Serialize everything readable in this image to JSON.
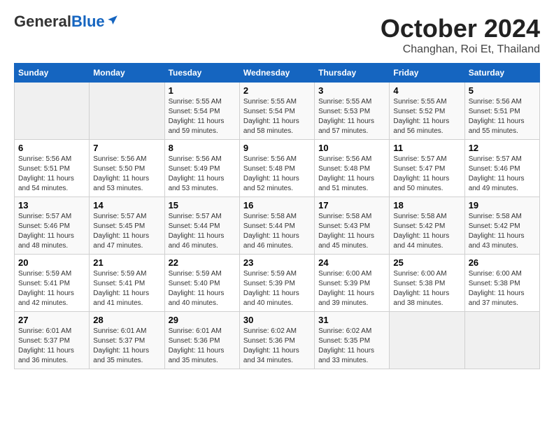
{
  "header": {
    "logo_general": "General",
    "logo_blue": "Blue",
    "month": "October 2024",
    "location": "Changhan, Roi Et, Thailand"
  },
  "weekdays": [
    "Sunday",
    "Monday",
    "Tuesday",
    "Wednesday",
    "Thursday",
    "Friday",
    "Saturday"
  ],
  "weeks": [
    [
      {
        "day": "",
        "sunrise": "",
        "sunset": "",
        "daylight": ""
      },
      {
        "day": "",
        "sunrise": "",
        "sunset": "",
        "daylight": ""
      },
      {
        "day": "1",
        "sunrise": "Sunrise: 5:55 AM",
        "sunset": "Sunset: 5:54 PM",
        "daylight": "Daylight: 11 hours and 59 minutes."
      },
      {
        "day": "2",
        "sunrise": "Sunrise: 5:55 AM",
        "sunset": "Sunset: 5:54 PM",
        "daylight": "Daylight: 11 hours and 58 minutes."
      },
      {
        "day": "3",
        "sunrise": "Sunrise: 5:55 AM",
        "sunset": "Sunset: 5:53 PM",
        "daylight": "Daylight: 11 hours and 57 minutes."
      },
      {
        "day": "4",
        "sunrise": "Sunrise: 5:55 AM",
        "sunset": "Sunset: 5:52 PM",
        "daylight": "Daylight: 11 hours and 56 minutes."
      },
      {
        "day": "5",
        "sunrise": "Sunrise: 5:56 AM",
        "sunset": "Sunset: 5:51 PM",
        "daylight": "Daylight: 11 hours and 55 minutes."
      }
    ],
    [
      {
        "day": "6",
        "sunrise": "Sunrise: 5:56 AM",
        "sunset": "Sunset: 5:51 PM",
        "daylight": "Daylight: 11 hours and 54 minutes."
      },
      {
        "day": "7",
        "sunrise": "Sunrise: 5:56 AM",
        "sunset": "Sunset: 5:50 PM",
        "daylight": "Daylight: 11 hours and 53 minutes."
      },
      {
        "day": "8",
        "sunrise": "Sunrise: 5:56 AM",
        "sunset": "Sunset: 5:49 PM",
        "daylight": "Daylight: 11 hours and 53 minutes."
      },
      {
        "day": "9",
        "sunrise": "Sunrise: 5:56 AM",
        "sunset": "Sunset: 5:48 PM",
        "daylight": "Daylight: 11 hours and 52 minutes."
      },
      {
        "day": "10",
        "sunrise": "Sunrise: 5:56 AM",
        "sunset": "Sunset: 5:48 PM",
        "daylight": "Daylight: 11 hours and 51 minutes."
      },
      {
        "day": "11",
        "sunrise": "Sunrise: 5:57 AM",
        "sunset": "Sunset: 5:47 PM",
        "daylight": "Daylight: 11 hours and 50 minutes."
      },
      {
        "day": "12",
        "sunrise": "Sunrise: 5:57 AM",
        "sunset": "Sunset: 5:46 PM",
        "daylight": "Daylight: 11 hours and 49 minutes."
      }
    ],
    [
      {
        "day": "13",
        "sunrise": "Sunrise: 5:57 AM",
        "sunset": "Sunset: 5:46 PM",
        "daylight": "Daylight: 11 hours and 48 minutes."
      },
      {
        "day": "14",
        "sunrise": "Sunrise: 5:57 AM",
        "sunset": "Sunset: 5:45 PM",
        "daylight": "Daylight: 11 hours and 47 minutes."
      },
      {
        "day": "15",
        "sunrise": "Sunrise: 5:57 AM",
        "sunset": "Sunset: 5:44 PM",
        "daylight": "Daylight: 11 hours and 46 minutes."
      },
      {
        "day": "16",
        "sunrise": "Sunrise: 5:58 AM",
        "sunset": "Sunset: 5:44 PM",
        "daylight": "Daylight: 11 hours and 46 minutes."
      },
      {
        "day": "17",
        "sunrise": "Sunrise: 5:58 AM",
        "sunset": "Sunset: 5:43 PM",
        "daylight": "Daylight: 11 hours and 45 minutes."
      },
      {
        "day": "18",
        "sunrise": "Sunrise: 5:58 AM",
        "sunset": "Sunset: 5:42 PM",
        "daylight": "Daylight: 11 hours and 44 minutes."
      },
      {
        "day": "19",
        "sunrise": "Sunrise: 5:58 AM",
        "sunset": "Sunset: 5:42 PM",
        "daylight": "Daylight: 11 hours and 43 minutes."
      }
    ],
    [
      {
        "day": "20",
        "sunrise": "Sunrise: 5:59 AM",
        "sunset": "Sunset: 5:41 PM",
        "daylight": "Daylight: 11 hours and 42 minutes."
      },
      {
        "day": "21",
        "sunrise": "Sunrise: 5:59 AM",
        "sunset": "Sunset: 5:41 PM",
        "daylight": "Daylight: 11 hours and 41 minutes."
      },
      {
        "day": "22",
        "sunrise": "Sunrise: 5:59 AM",
        "sunset": "Sunset: 5:40 PM",
        "daylight": "Daylight: 11 hours and 40 minutes."
      },
      {
        "day": "23",
        "sunrise": "Sunrise: 5:59 AM",
        "sunset": "Sunset: 5:39 PM",
        "daylight": "Daylight: 11 hours and 40 minutes."
      },
      {
        "day": "24",
        "sunrise": "Sunrise: 6:00 AM",
        "sunset": "Sunset: 5:39 PM",
        "daylight": "Daylight: 11 hours and 39 minutes."
      },
      {
        "day": "25",
        "sunrise": "Sunrise: 6:00 AM",
        "sunset": "Sunset: 5:38 PM",
        "daylight": "Daylight: 11 hours and 38 minutes."
      },
      {
        "day": "26",
        "sunrise": "Sunrise: 6:00 AM",
        "sunset": "Sunset: 5:38 PM",
        "daylight": "Daylight: 11 hours and 37 minutes."
      }
    ],
    [
      {
        "day": "27",
        "sunrise": "Sunrise: 6:01 AM",
        "sunset": "Sunset: 5:37 PM",
        "daylight": "Daylight: 11 hours and 36 minutes."
      },
      {
        "day": "28",
        "sunrise": "Sunrise: 6:01 AM",
        "sunset": "Sunset: 5:37 PM",
        "daylight": "Daylight: 11 hours and 35 minutes."
      },
      {
        "day": "29",
        "sunrise": "Sunrise: 6:01 AM",
        "sunset": "Sunset: 5:36 PM",
        "daylight": "Daylight: 11 hours and 35 minutes."
      },
      {
        "day": "30",
        "sunrise": "Sunrise: 6:02 AM",
        "sunset": "Sunset: 5:36 PM",
        "daylight": "Daylight: 11 hours and 34 minutes."
      },
      {
        "day": "31",
        "sunrise": "Sunrise: 6:02 AM",
        "sunset": "Sunset: 5:35 PM",
        "daylight": "Daylight: 11 hours and 33 minutes."
      },
      {
        "day": "",
        "sunrise": "",
        "sunset": "",
        "daylight": ""
      },
      {
        "day": "",
        "sunrise": "",
        "sunset": "",
        "daylight": ""
      }
    ]
  ]
}
